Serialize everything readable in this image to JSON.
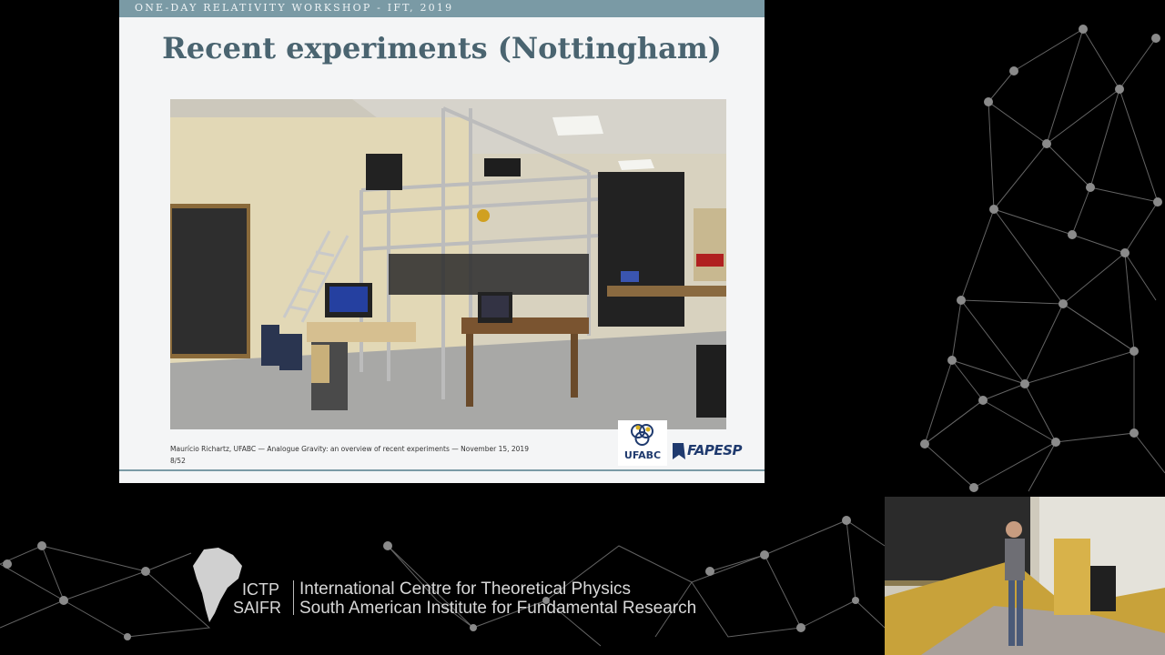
{
  "slide": {
    "header": "ONE-DAY RELATIVITY WORKSHOP - IFT, 2019",
    "title": "Recent experiments (Nottingham)",
    "photo_alt": "",
    "footer": "Maurício Richartz, UFABC — Analogue Gravity: an overview of recent experiments — November 15, 2019",
    "page": "8/52",
    "logos": {
      "ufabc": "UFABC",
      "fapesp": "FAPESP"
    }
  },
  "branding": {
    "acronym_top": "ICTP",
    "acronym_bottom": "SAIFR",
    "name_line1": "International Centre for Theoretical Physics",
    "name_line2": "South American Institute for Fundamental Research"
  },
  "colors": {
    "background": "#000000",
    "slide_bg": "#f4f5f6",
    "slide_accent": "#7a9aa5",
    "title": "#4a6470",
    "network": "#8a8a8a"
  }
}
